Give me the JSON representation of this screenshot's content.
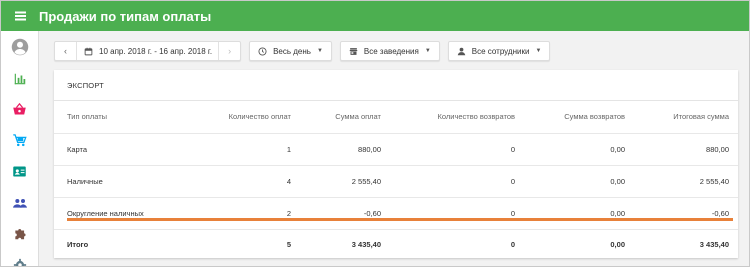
{
  "app": {
    "title": "Продажи по типам оплаты"
  },
  "colors": {
    "appbar": "#4caf50",
    "highlight": "#e8813a"
  },
  "sidebar": {
    "items": [
      {
        "icon": "account-circle-icon"
      },
      {
        "icon": "bar-chart-icon"
      },
      {
        "icon": "basket-icon"
      },
      {
        "icon": "cart-icon"
      },
      {
        "icon": "contact-card-icon"
      },
      {
        "icon": "people-icon"
      },
      {
        "icon": "puzzle-icon"
      },
      {
        "icon": "gear-icon"
      }
    ]
  },
  "toolbar": {
    "prev": "‹",
    "next": "›",
    "date_range": "10 апр. 2018 г. - 16 апр. 2018 г.",
    "time_filter": "Весь день",
    "venue_filter": "Все заведения",
    "staff_filter": "Все сотрудники"
  },
  "report": {
    "section_title": "ЭКСПОРТ",
    "columns": [
      "Тип оплаты",
      "Количество оплат",
      "Сумма оплат",
      "Количество возвратов",
      "Сумма возвратов",
      "Итоговая сумма"
    ],
    "rows": [
      [
        "Карта",
        "1",
        "880,00",
        "0",
        "0,00",
        "880,00"
      ],
      [
        "Наличные",
        "4",
        "2 555,40",
        "0",
        "0,00",
        "2 555,40"
      ],
      [
        "Округление наличных",
        "2",
        "-0,60",
        "0",
        "0,00",
        "-0,60"
      ]
    ],
    "total": [
      "Итого",
      "5",
      "3 435,40",
      "0",
      "0,00",
      "3 435,40"
    ]
  }
}
